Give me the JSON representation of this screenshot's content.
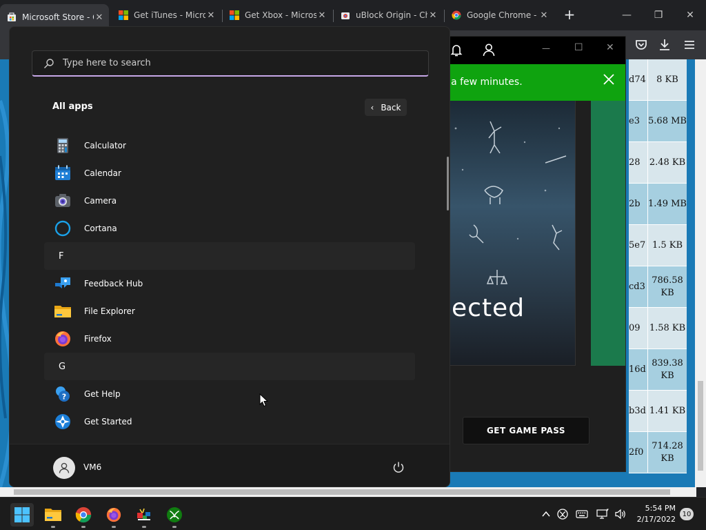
{
  "browser": {
    "tabs": [
      {
        "title": "Microsoft Store - Get",
        "active": true
      },
      {
        "title": "Get iTunes - Microsoft",
        "active": false
      },
      {
        "title": "Get Xbox - Microsoft",
        "active": false
      },
      {
        "title": "uBlock Origin - Chrome",
        "active": false
      },
      {
        "title": "Google Chrome - Do",
        "active": false
      }
    ],
    "tab_close_glyph": "✕",
    "new_tab_glyph": "+",
    "window_controls": {
      "minimize": "—",
      "maximize": "❐",
      "close": "✕"
    }
  },
  "file_table": {
    "rows": [
      {
        "hash": "d74",
        "size": "8 KB"
      },
      {
        "hash": "e3",
        "size": "5.68 MB"
      },
      {
        "hash": "28",
        "size": "2.48 KB"
      },
      {
        "hash": "2b",
        "size": "1.49 MB"
      },
      {
        "hash": "5e7",
        "size": "1.5 KB"
      },
      {
        "hash": "cd3",
        "size": "786.58 KB"
      },
      {
        "hash": "09",
        "size": "1.58 KB"
      },
      {
        "hash": "16d",
        "size": "839.38 KB"
      },
      {
        "hash": "b3d",
        "size": "1.41 KB"
      },
      {
        "hash": "2f0",
        "size": "714.28 KB"
      }
    ]
  },
  "store_window": {
    "banner_message": "e a few minutes.",
    "hero_text": "ected",
    "game_pass_button": "GET GAME PASS",
    "window_controls": {
      "minimize": "—",
      "maximize": "☐",
      "close": "✕"
    },
    "colors": {
      "banner": "#0fa30f",
      "panel": "#1b7a4c"
    }
  },
  "start_menu": {
    "search": {
      "placeholder": "Type here to search",
      "value": ""
    },
    "section_title": "All apps",
    "back_label": "Back",
    "apps": [
      {
        "type": "app",
        "label": "Calculator",
        "icon": "calculator-icon"
      },
      {
        "type": "app",
        "label": "Calendar",
        "icon": "calendar-icon"
      },
      {
        "type": "app",
        "label": "Camera",
        "icon": "camera-icon"
      },
      {
        "type": "app",
        "label": "Cortana",
        "icon": "cortana-icon"
      },
      {
        "type": "letter",
        "label": "F"
      },
      {
        "type": "app",
        "label": "Feedback Hub",
        "icon": "feedback-hub-icon"
      },
      {
        "type": "app",
        "label": "File Explorer",
        "icon": "file-explorer-icon"
      },
      {
        "type": "app",
        "label": "Firefox",
        "icon": "firefox-icon"
      },
      {
        "type": "letter",
        "label": "G"
      },
      {
        "type": "app",
        "label": "Get Help",
        "icon": "get-help-icon"
      },
      {
        "type": "app",
        "label": "Get Started",
        "icon": "get-started-icon"
      }
    ],
    "user": {
      "name": "VM6"
    }
  },
  "taskbar": {
    "apps": [
      "start-icon",
      "file-explorer-icon",
      "chrome-icon",
      "firefox-icon",
      "media-app-icon",
      "xbox-icon"
    ],
    "tray": [
      "chevron-up-icon",
      "xbox-tray-icon",
      "keyboard-icon",
      "network-icon",
      "volume-icon"
    ],
    "clock": {
      "time": "5:54 PM",
      "date": "2/17/2022"
    },
    "notification_count": "10"
  }
}
